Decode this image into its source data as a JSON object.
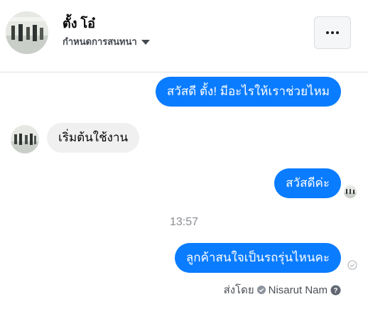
{
  "header": {
    "contact_name": "ตั้ง โอ๋",
    "subtitle": "กำหนดการสนทนา",
    "more_icon": "more-horizontal-icon",
    "avatar": "avatar"
  },
  "messages": [
    {
      "direction": "outgoing",
      "text": "สวัสดี ตั้ง! มีอะไรให้เราช่วยไหม"
    },
    {
      "direction": "incoming",
      "text": "เริ่มต้นใช้งาน"
    },
    {
      "direction": "outgoing",
      "text": "สวัสดีค่ะ"
    },
    {
      "direction": "outgoing",
      "text": "ลูกค้าสนใจเป็นรถรุ่นไหนคะ"
    }
  ],
  "timestamp": "13:57",
  "sent_by": {
    "label": "ส่งโดย",
    "name": "Nisarut Nam"
  },
  "colors": {
    "outgoing_bubble": "#0a7cff",
    "incoming_bubble": "#f0f0f0",
    "timestamp": "#8a8d91"
  }
}
